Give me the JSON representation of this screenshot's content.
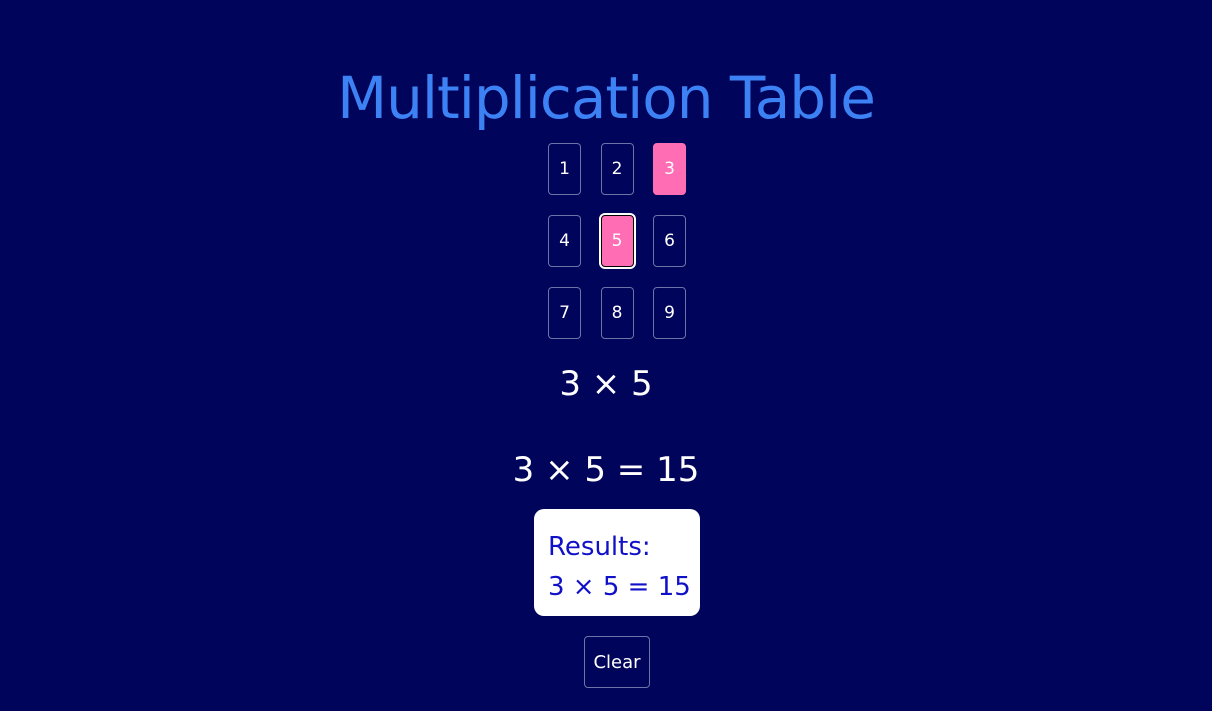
{
  "title": "Multiplication Table",
  "colors": {
    "background": "#00045a",
    "title": "#3d82f4",
    "selected": "#ff6eb4",
    "results_text": "#1010c8"
  },
  "numbers": [
    {
      "label": "1",
      "selected": false
    },
    {
      "label": "2",
      "selected": false
    },
    {
      "label": "3",
      "selected": true
    },
    {
      "label": "4",
      "selected": false
    },
    {
      "label": "5",
      "selected": true,
      "focused": true
    },
    {
      "label": "6",
      "selected": false
    },
    {
      "label": "7",
      "selected": false
    },
    {
      "label": "8",
      "selected": false
    },
    {
      "label": "9",
      "selected": false
    }
  ],
  "expression": "3 × 5",
  "answer": "3 × 5 = 15",
  "results": {
    "heading": "Results:",
    "items": [
      "3 × 5 = 15"
    ]
  },
  "clear_label": "Clear"
}
